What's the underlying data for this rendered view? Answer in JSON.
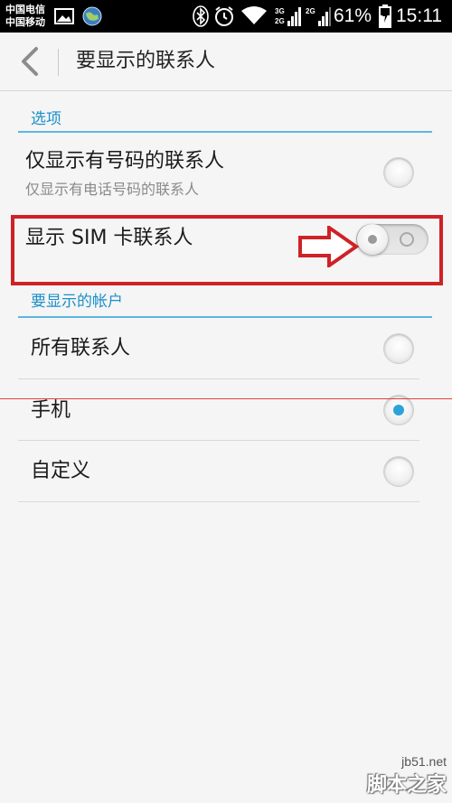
{
  "status_bar": {
    "carrier_1": "中国电信",
    "carrier_2": "中国移动",
    "sig1_type": "3G",
    "sig1_type2": "2G",
    "sig2_type": "2G",
    "battery": "61%",
    "time": "15:11",
    "icons": [
      "image-icon",
      "globe-icon",
      "bluetooth-icon",
      "alarm-icon",
      "wifi-icon",
      "signal-icon",
      "battery-charging-icon"
    ]
  },
  "action_bar": {
    "back_icon": "chevron-left-icon",
    "title": "要显示的联系人"
  },
  "options_section": {
    "header": "选项",
    "items": [
      {
        "label": "仅显示有号码的联系人",
        "sublabel": "仅显示有电话号码的联系人",
        "control": "radio",
        "checked": false
      },
      {
        "label": "显示 SIM 卡联系人",
        "control": "toggle",
        "on": false
      }
    ]
  },
  "accounts_section": {
    "header": "要显示的帐户",
    "items": [
      {
        "label": "所有联系人",
        "checked": false
      },
      {
        "label": "手机",
        "checked": true
      },
      {
        "label": "自定义",
        "checked": false
      }
    ]
  },
  "colors": {
    "accent": "#1a8fc9",
    "highlight": "#cf2226",
    "radio_selected": "#2ba3da"
  },
  "watermark": {
    "url": "jb51.net",
    "name": "脚本之家"
  }
}
